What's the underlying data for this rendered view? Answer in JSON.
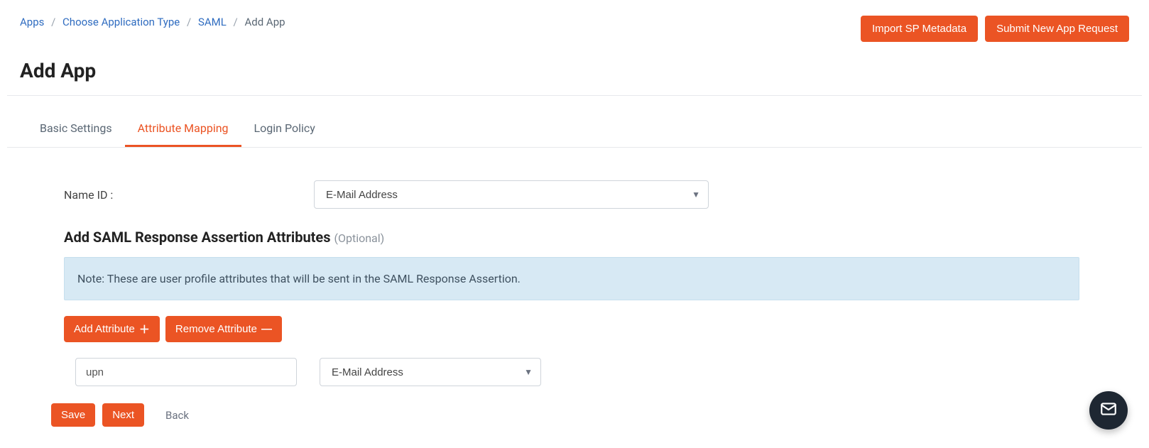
{
  "breadcrumb": {
    "items": [
      {
        "label": "Apps",
        "link": true
      },
      {
        "label": "Choose Application Type",
        "link": true
      },
      {
        "label": "SAML",
        "link": true
      },
      {
        "label": "Add App",
        "link": false
      }
    ]
  },
  "header_actions": {
    "import_sp": "Import SP Metadata",
    "submit_request": "Submit New App Request"
  },
  "page_title": "Add App",
  "tabs": {
    "basic": "Basic Settings",
    "attribute": "Attribute Mapping",
    "login": "Login Policy",
    "active": "attribute"
  },
  "form": {
    "name_id_label": "Name ID :",
    "name_id_value": "E-Mail Address",
    "section_title": "Add SAML Response Assertion Attributes",
    "section_optional": "(Optional)",
    "note": "Note: These are user profile attributes that will be sent in the SAML Response Assertion.",
    "add_attr_label": "Add Attribute",
    "remove_attr_label": "Remove Attribute",
    "attr_name_value": "upn",
    "attr_map_value": "E-Mail Address"
  },
  "footer": {
    "save": "Save",
    "next": "Next",
    "back": "Back"
  }
}
